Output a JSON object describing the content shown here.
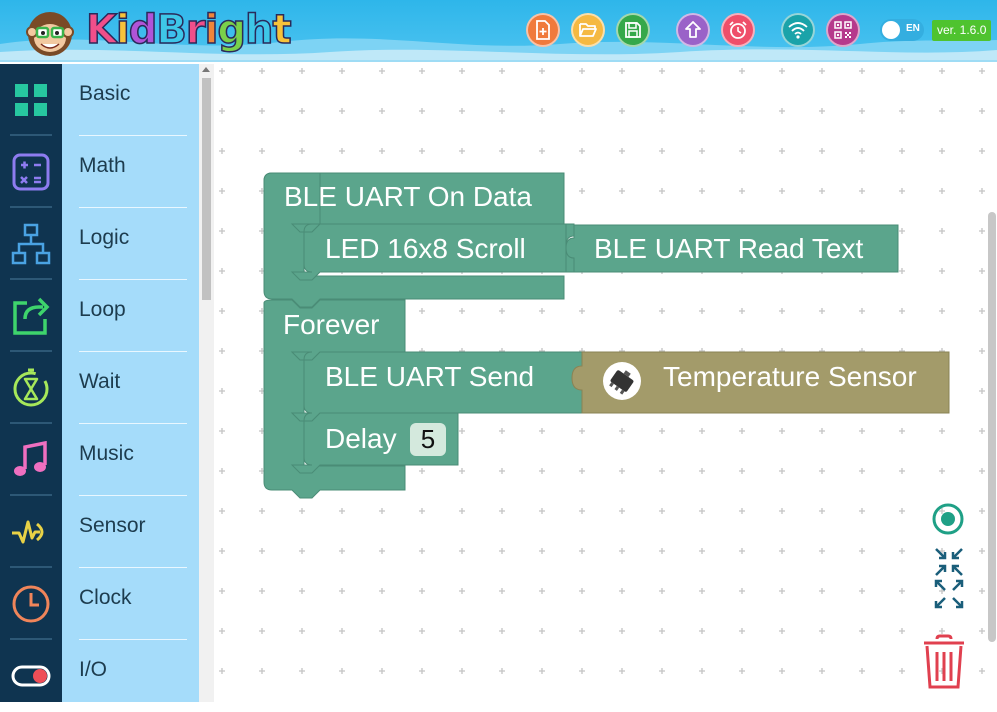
{
  "app": {
    "name": "KidBright",
    "version": "ver. 1.6.0",
    "language": "EN"
  },
  "toolbar": {
    "buttons": [
      {
        "name": "new-file",
        "color": "#f07a3c"
      },
      {
        "name": "open-folder",
        "color": "#f5b942"
      },
      {
        "name": "save",
        "color": "#35a84a"
      },
      {
        "name": "upload",
        "color": "#9a62c8"
      },
      {
        "name": "alarm",
        "color": "#ef4f6a"
      },
      {
        "name": "wifi",
        "color": "#1aa3a9"
      },
      {
        "name": "qr-code",
        "color": "#b63a8c"
      }
    ]
  },
  "sidebar": {
    "items": [
      {
        "label": "Basic",
        "icon": "grid-icon",
        "color": "#27c7a0"
      },
      {
        "label": "Math",
        "icon": "calculator-icon",
        "color": "#8e7cf0"
      },
      {
        "label": "Logic",
        "icon": "flowchart-icon",
        "color": "#4aa3e3"
      },
      {
        "label": "Loop",
        "icon": "loop-icon",
        "color": "#3ed46c"
      },
      {
        "label": "Wait",
        "icon": "timer-icon",
        "color": "#a6e85a"
      },
      {
        "label": "Music",
        "icon": "music-note-icon",
        "color": "#ef6fc0"
      },
      {
        "label": "Sensor",
        "icon": "signal-icon",
        "color": "#e8d246"
      },
      {
        "label": "Clock",
        "icon": "clock-icon",
        "color": "#f0855a"
      },
      {
        "label": "I/O",
        "icon": "toggle-icon",
        "color": "#ef4e57"
      }
    ]
  },
  "workspace": {
    "blocks": {
      "ble_on_data": "BLE UART On Data",
      "led_scroll": "LED 16x8 Scroll",
      "ble_read_text": "BLE UART Read Text",
      "forever": "Forever",
      "ble_send": "BLE UART Send",
      "temperature_sensor": "Temperature Sensor",
      "delay": "Delay",
      "delay_value": "5"
    },
    "colors": {
      "block_green": "#5ba58c",
      "block_border": "#4a8c76",
      "sensor_block": "#a39b6a",
      "control_teal": "#1fa086",
      "trash_red": "#e0404f"
    }
  }
}
